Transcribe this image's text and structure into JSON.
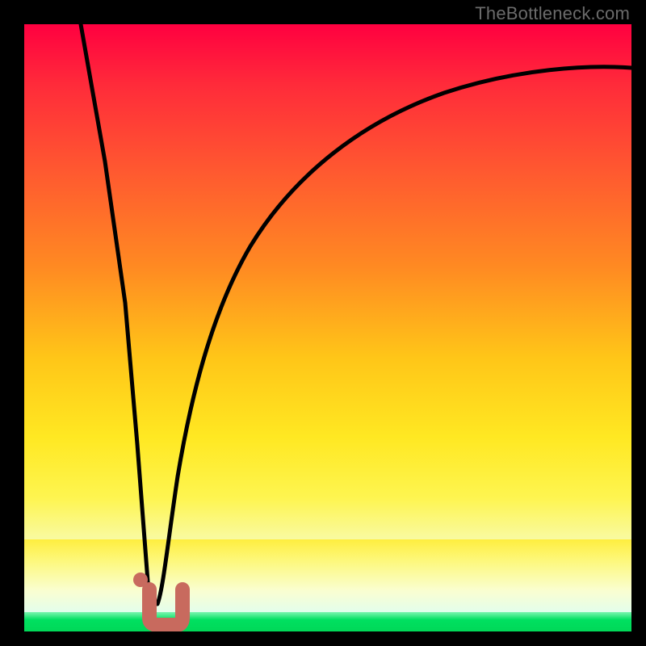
{
  "watermark": "TheBottleneck.com",
  "colors": {
    "curve": "#000000",
    "marker": "#c86a5e",
    "frame": "#000000"
  },
  "chart_data": {
    "type": "line",
    "title": "",
    "xlabel": "",
    "ylabel": "",
    "xlim": [
      0,
      100
    ],
    "ylim": [
      0,
      100
    ],
    "series": [
      {
        "name": "descending-left",
        "x": [
          10,
          14,
          17,
          19,
          20.5
        ],
        "values": [
          100,
          72,
          45,
          20,
          6
        ]
      },
      {
        "name": "valley-and-rise",
        "x": [
          20.5,
          22,
          24,
          26,
          29,
          33,
          38,
          45,
          55,
          68,
          82,
          100
        ],
        "values": [
          6,
          7,
          18,
          34,
          50,
          62,
          72,
          79,
          84,
          88,
          90.5,
          92
        ]
      }
    ],
    "annotations": [
      {
        "name": "marker-j",
        "x": 21.5,
        "y": 4.5
      }
    ]
  }
}
